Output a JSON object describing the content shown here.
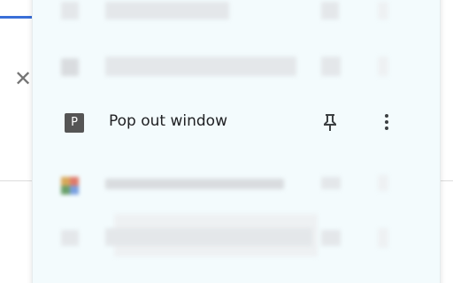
{
  "background": {
    "close_glyph": "✕",
    "accent_color": "#3a6fd8"
  },
  "menu": {
    "focused_item": {
      "favicon_letter": "P",
      "title": "Pop out window",
      "pin_icon": "pin-icon",
      "more_icon": "more-vert-icon"
    }
  },
  "colors": {
    "panel_background": "#f3fbfd",
    "favicon_background": "#555555",
    "text": "#202124",
    "icon": "#3c4043"
  }
}
